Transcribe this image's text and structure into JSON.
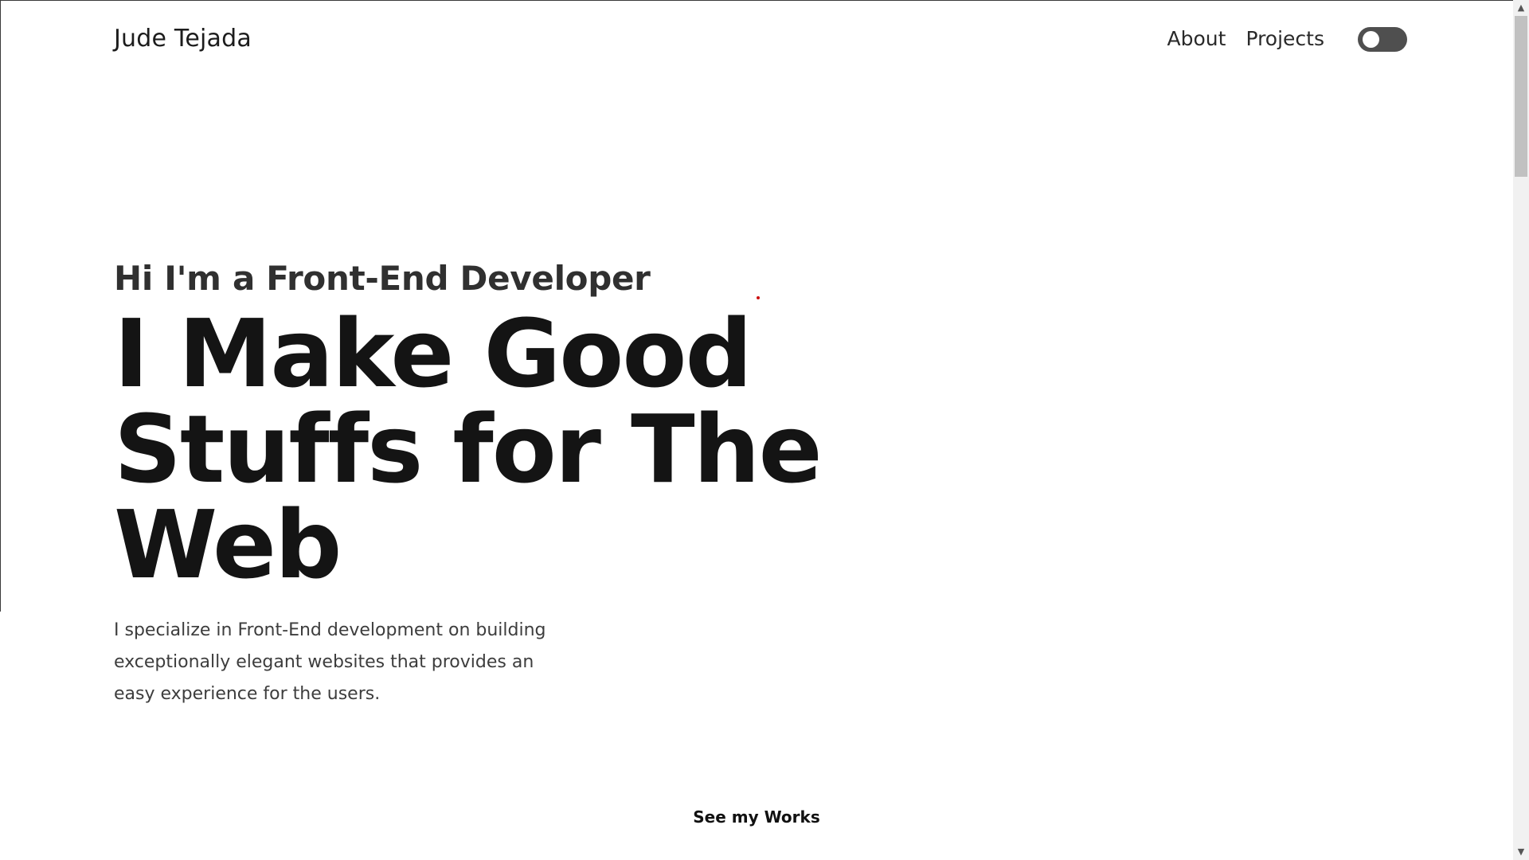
{
  "header": {
    "brand": "Jude Tejada",
    "nav": {
      "about": "About",
      "projects": "Projects"
    },
    "theme_toggle": {
      "state": "off"
    }
  },
  "hero": {
    "subtitle": "Hi I'm a Front-End Developer",
    "headline": "I Make Good Stuffs for The Web",
    "description": "I specialize in Front-End development on building exceptionally elegant websites that provides an easy experience for the users."
  },
  "cta": {
    "label": "See my Works"
  },
  "scrollbar": {
    "up_icon": "chevron-up-icon",
    "down_icon": "chevron-down-icon"
  },
  "colors": {
    "toggle_track": "#4f4f4f",
    "text_primary": "#141414",
    "text_secondary": "#3d3d3d",
    "accent_dot": "#cc1010"
  }
}
